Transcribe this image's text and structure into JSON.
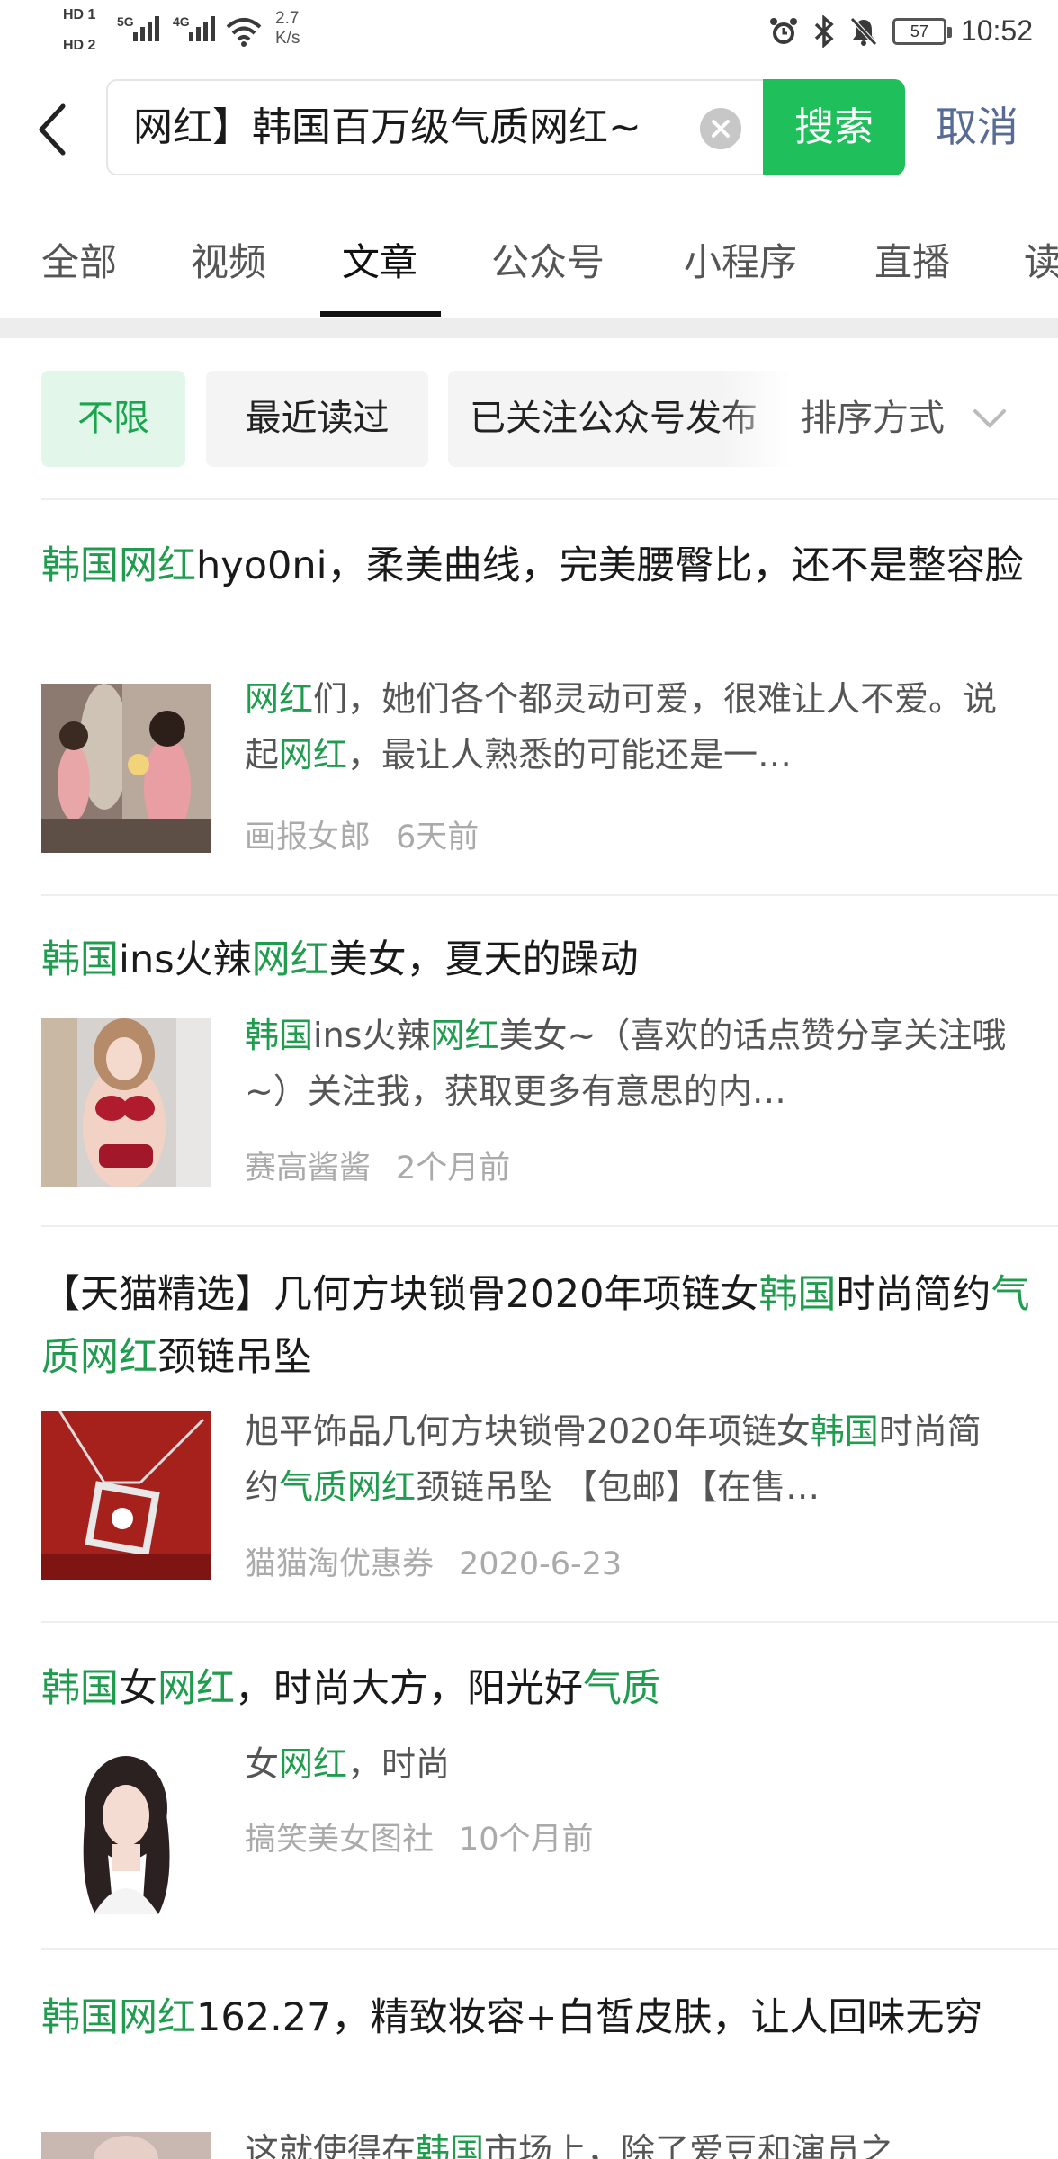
{
  "status_bar": {
    "hd1": "HD 1",
    "hd2": "HD 2",
    "sig1": "5G",
    "sig2": "4G",
    "speed_value": "2.7",
    "speed_unit": "K/s",
    "battery": "57",
    "time": "10:52"
  },
  "search": {
    "query": "网红】韩国百万级气质网红~",
    "button": "搜索",
    "cancel": "取消"
  },
  "tabs": [
    "全部",
    "视频",
    "文章",
    "公众号",
    "小程序",
    "直播",
    "读"
  ],
  "active_tab": "文章",
  "filters": {
    "chips": [
      "不限",
      "最近读过",
      "已关注公众号发布"
    ],
    "sort": "排序方式"
  },
  "colors": {
    "accent": "#1fbf5b",
    "highlight": "#1f9c4e",
    "link": "#576b95"
  },
  "results": [
    {
      "title": [
        {
          "t": "韩国网红",
          "h": true
        },
        {
          "t": "hyo0ni，柔美曲线，完美腰臀比，还不是整容脸",
          "h": false
        }
      ],
      "snippet": [
        {
          "t": "网红",
          "h": true
        },
        {
          "t": "们，她们各个都灵动可爱，很难让人不爱。说起",
          "h": false
        },
        {
          "t": "网红",
          "h": true
        },
        {
          "t": "，最让人熟悉的可能还是一…",
          "h": false
        }
      ],
      "source": "画报女郎",
      "time": "6天前",
      "thumb": "photo"
    },
    {
      "title": [
        {
          "t": "韩国",
          "h": true
        },
        {
          "t": "ins火辣",
          "h": false
        },
        {
          "t": "网红",
          "h": true
        },
        {
          "t": "美女，夏天的躁动",
          "h": false
        }
      ],
      "snippet": [
        {
          "t": "韩国",
          "h": true
        },
        {
          "t": "ins火辣",
          "h": false
        },
        {
          "t": "网红",
          "h": true
        },
        {
          "t": "美女~（喜欢的话点赞分享关注哦~）关注我，获取更多有意思的内…",
          "h": false
        }
      ],
      "source": "赛高酱酱",
      "time": "2个月前",
      "thumb": "photo"
    },
    {
      "title": [
        {
          "t": "【天猫精选】几何方块锁骨2020年项链女",
          "h": false
        },
        {
          "t": "韩国",
          "h": true
        },
        {
          "t": "时尚简约",
          "h": false
        },
        {
          "t": "气质网红",
          "h": true
        },
        {
          "t": "颈链吊坠",
          "h": false
        }
      ],
      "snippet": [
        {
          "t": "旭平饰品几何方块锁骨2020年项链女",
          "h": false
        },
        {
          "t": "韩国",
          "h": true
        },
        {
          "t": "时尚简约",
          "h": false
        },
        {
          "t": "气质网红",
          "h": true
        },
        {
          "t": "颈链吊坠 【包邮】【在售…",
          "h": false
        }
      ],
      "source": "猫猫淘优惠券",
      "time": "2020-6-23",
      "thumb": "photo"
    },
    {
      "title": [
        {
          "t": "韩国",
          "h": true
        },
        {
          "t": "女",
          "h": false
        },
        {
          "t": "网红",
          "h": true
        },
        {
          "t": "，时尚大方，阳光好",
          "h": false
        },
        {
          "t": "气质",
          "h": true
        }
      ],
      "snippet": [
        {
          "t": "女",
          "h": false
        },
        {
          "t": "网红",
          "h": true
        },
        {
          "t": "，时尚",
          "h": false
        }
      ],
      "source": "搞笑美女图社",
      "time": "10个月前",
      "thumb": "photo"
    },
    {
      "title": [
        {
          "t": "韩国网红",
          "h": true
        },
        {
          "t": "162.27，精致妆容+白皙皮肤，让人回味无穷",
          "h": false
        }
      ],
      "snippet": [
        {
          "t": "这就使得在",
          "h": false
        },
        {
          "t": "韩国",
          "h": true
        },
        {
          "t": "市场上，除了爱豆和演员之",
          "h": false
        }
      ],
      "source": "",
      "time": "",
      "thumb": "photo"
    }
  ]
}
